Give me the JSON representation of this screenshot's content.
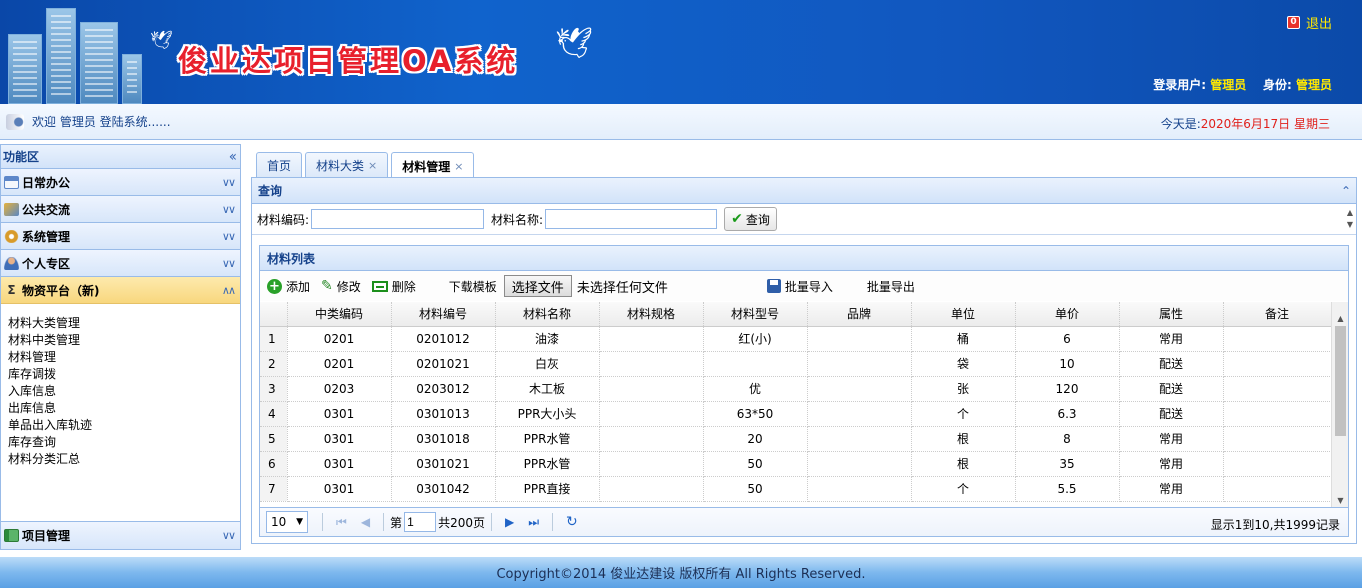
{
  "header": {
    "title": "俊业达项目管理OA系统",
    "logout_label": "退出",
    "login_user_label": "登录用户:",
    "login_user": "管理员",
    "role_label": "身份:",
    "role": "管理员"
  },
  "welcome": {
    "text": "欢迎 管理员 登陆系统......",
    "date_prefix": "今天是:",
    "date": "2020年6月17日 星期三"
  },
  "sidebar": {
    "title": "功能区",
    "sections": [
      {
        "label": "日常办公",
        "icon": "calendar-icon"
      },
      {
        "label": "公共交流",
        "icon": "pen-icon"
      },
      {
        "label": "系统管理",
        "icon": "gear-icon"
      },
      {
        "label": "个人专区",
        "icon": "user-icon"
      },
      {
        "label": "物资平台（新)",
        "icon": "sigma-icon"
      }
    ],
    "items": [
      "材料大类管理",
      "材料中类管理",
      "材料管理",
      "库存调拨",
      "入库信息",
      "出库信息",
      "单品出入库轨迹",
      "库存查询",
      "材料分类汇总"
    ],
    "bottom_section": {
      "label": "项目管理",
      "icon": "book-icon"
    }
  },
  "tabs": [
    {
      "label": "首页",
      "closable": false
    },
    {
      "label": "材料大类",
      "closable": true
    },
    {
      "label": "材料管理",
      "closable": true
    }
  ],
  "query": {
    "title": "查询",
    "code_label": "材料编码:",
    "code_value": "",
    "name_label": "材料名称:",
    "name_value": "",
    "search_label": "查询"
  },
  "list": {
    "title": "材料列表",
    "toolbar": {
      "add": "添加",
      "edit": "修改",
      "delete": "删除",
      "download_template": "下载模板",
      "choose_file": "选择文件",
      "no_file": "未选择任何文件",
      "batch_import": "批量导入",
      "batch_export": "批量导出"
    },
    "columns": [
      "中类编码",
      "材料编号",
      "材料名称",
      "材料规格",
      "材料型号",
      "品牌",
      "单位",
      "单价",
      "属性",
      "备注"
    ],
    "rows": [
      [
        "1",
        "0201",
        "0201012",
        "油漆",
        "",
        "红(小)",
        "",
        "桶",
        "6",
        "常用",
        ""
      ],
      [
        "2",
        "0201",
        "0201021",
        "白灰",
        "",
        "",
        "",
        "袋",
        "10",
        "配送",
        ""
      ],
      [
        "3",
        "0203",
        "0203012",
        "木工板",
        "",
        "优",
        "",
        "张",
        "120",
        "配送",
        ""
      ],
      [
        "4",
        "0301",
        "0301013",
        "PPR大小头",
        "",
        "63*50",
        "",
        "个",
        "6.3",
        "配送",
        ""
      ],
      [
        "5",
        "0301",
        "0301018",
        "PPR水管",
        "",
        "20",
        "",
        "根",
        "8",
        "常用",
        ""
      ],
      [
        "6",
        "0301",
        "0301021",
        "PPR水管",
        "",
        "50",
        "",
        "根",
        "35",
        "常用",
        ""
      ],
      [
        "7",
        "0301",
        "0301042",
        "PPR直接",
        "",
        "50",
        "",
        "个",
        "5.5",
        "常用",
        ""
      ]
    ]
  },
  "pager": {
    "page_size": "10",
    "page_prefix": "第",
    "current_page": "1",
    "total_pages": "共200页",
    "info": "显示1到10,共1999记录"
  },
  "footer": {
    "text": "Copyright©2014 俊业达建设 版权所有 All Rights Reserved."
  },
  "colors": {
    "header_blue": "#1063cc",
    "title_red": "#e8202c",
    "accent_yellow": "#ffe800",
    "border_blue": "#99bbe8",
    "panel_text": "#15428b"
  }
}
